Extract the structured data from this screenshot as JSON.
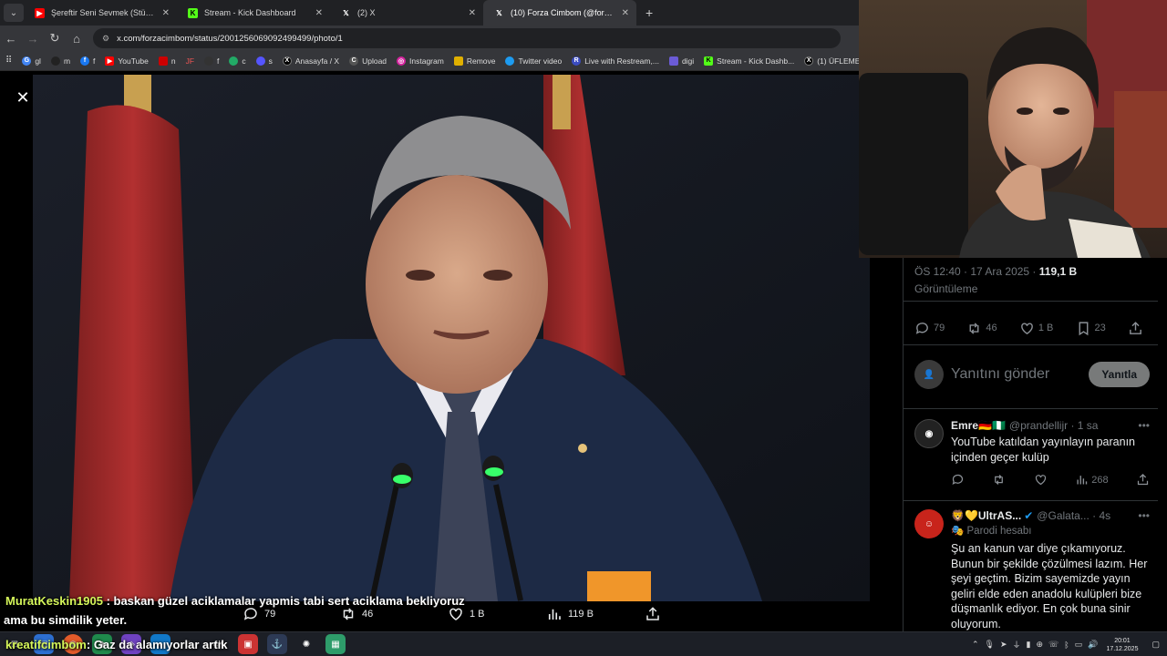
{
  "browser": {
    "tabs": [
      {
        "title": "Şereftir Seni Sevmek (Stüdyo) -",
        "icon": "youtube-icon",
        "color": "#ff0000",
        "active": false
      },
      {
        "title": "Stream - Kick Dashboard",
        "icon": "kick-icon",
        "color": "#53fc18",
        "active": false
      },
      {
        "title": "(2) X",
        "icon": "x-icon",
        "color": "#000000",
        "active": false
      },
      {
        "title": "(10) Forza Cimbom (@forzacim",
        "icon": "x-icon",
        "color": "#000000",
        "active": true
      }
    ],
    "url": "x.com/forzacimbom/status/2001256069092499499/photo/1",
    "bookmarks": [
      "gl",
      "m",
      "f",
      "YouTube",
      "n",
      "JF",
      "f",
      "c",
      "s",
      "Anasayfa / X",
      "Upload",
      "Instagram",
      "Remove",
      "Twitter video",
      "Live with Restream,...",
      "digi",
      "Stream - Kick Dashb...",
      "(1) ÜFLEME"
    ]
  },
  "chat_overlay": {
    "lines": [
      {
        "user": "MuratKeskin1905",
        "message": " : baskan güzel aciklamalar yapmis tabi sert aciklama bekliyoruz"
      },
      {
        "user": "",
        "message": "ama bu simdilik yeter."
      },
      {
        "user": "kreatifcimbom",
        "message": ": Gaz da alamıyorlar artık"
      }
    ]
  },
  "viewer_actions": {
    "replies": "79",
    "reposts": "46",
    "likes": "1 B",
    "views": "119 B"
  },
  "tweet": {
    "time": "ÖS 12:40 · 17 Ara 2025 · ",
    "views_count": "119,1 B",
    "views_label": "Görüntüleme",
    "replies": "79",
    "reposts": "46",
    "likes": "1 B",
    "bookmarks": "23"
  },
  "reply_composer": {
    "placeholder": "Yanıtını gönder",
    "button": "Yanıtla"
  },
  "replies": [
    {
      "name": "Emre🇩🇪🇳🇬",
      "handle": "@prandellijr · 1 sa",
      "text": "YouTube katıldan yayınlayın paranın içinden geçer kulüp",
      "views": "268"
    },
    {
      "name": "🦁💛UltrAS...",
      "handle": "@Galata... · 4s",
      "badge": "🎭 Parodi hesabı",
      "text": "Şu an kanun var diye çıkamıyoruz. Bunun bir şekilde çözülmesi lazım. Her şeyi geçtim. Bizim sayemizde yayın geliri elde eden anadolu kulüpleri bize düşmanlık ediyor. En çok buna sinir oluyorum."
    }
  ],
  "taskbar": {
    "clock_time": "20:01",
    "clock_date": "17.12.2025"
  },
  "colors": {
    "accent": "#1d9bf0",
    "chat_user": "#d5f65a",
    "x_text": "#e7e9ea",
    "x_muted": "#71767b"
  }
}
